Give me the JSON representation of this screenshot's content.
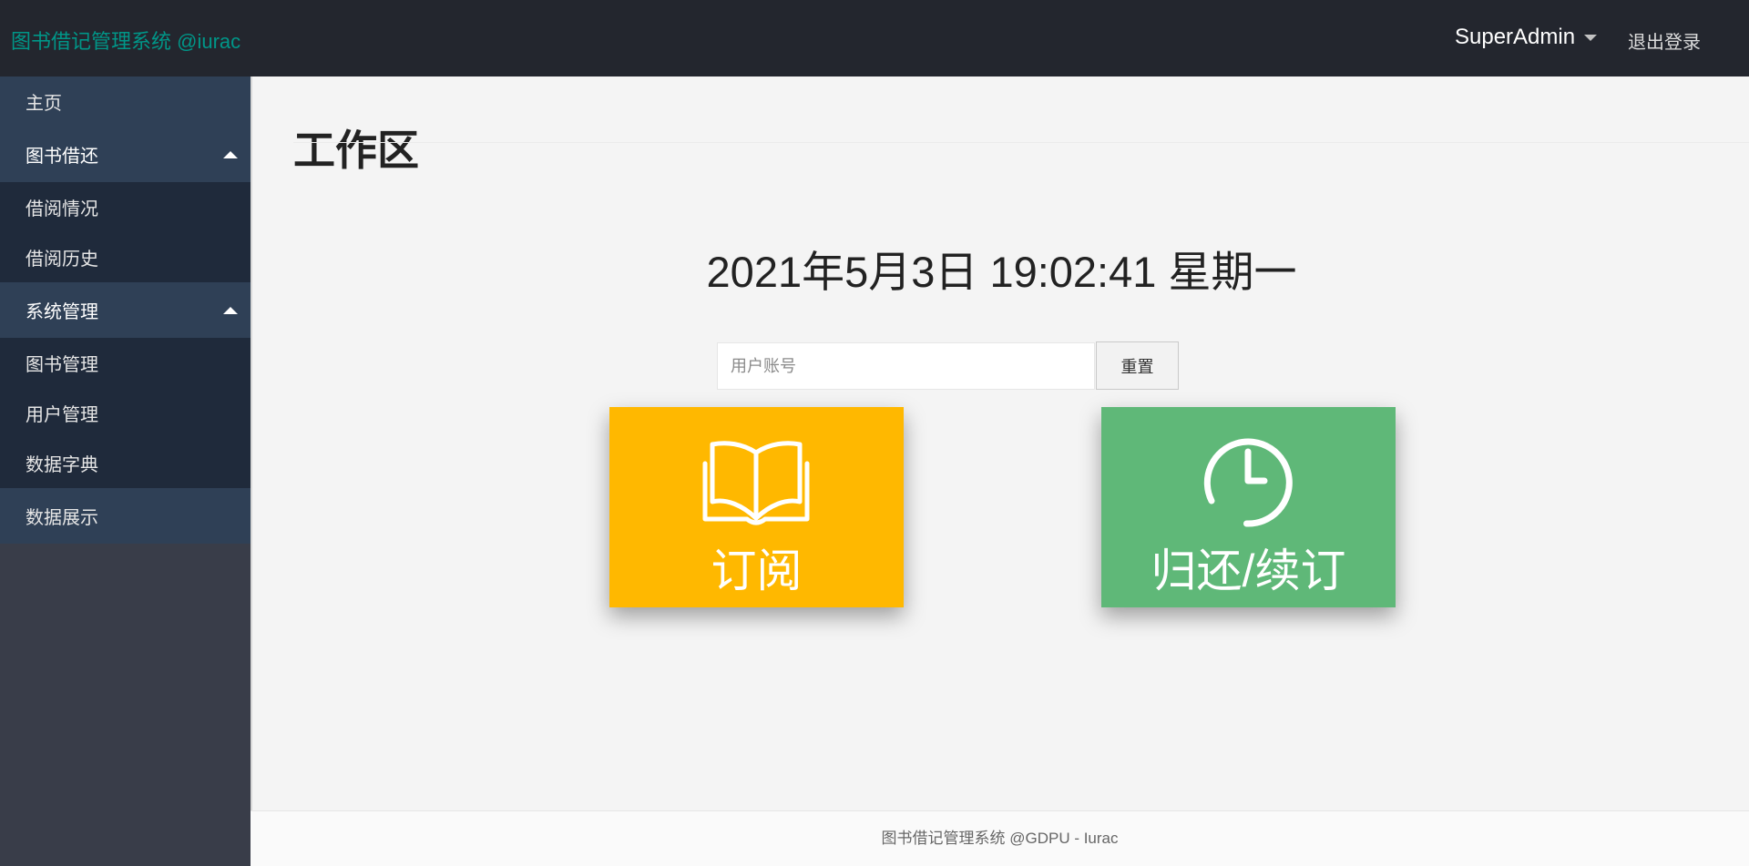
{
  "header": {
    "brand": "图书借记管理系统 @iurac",
    "user": "SuperAdmin",
    "logout": "退出登录"
  },
  "sidebar": {
    "home": "主页",
    "group1": {
      "label": "图书借还",
      "items": [
        "借阅情况",
        "借阅历史"
      ]
    },
    "group2": {
      "label": "系统管理",
      "items": [
        "图书管理",
        "用户管理",
        "数据字典"
      ]
    },
    "data_display": "数据展示"
  },
  "main": {
    "title": "工作区",
    "clock": "2021年5月3日 19:02:41 星期一",
    "search": {
      "placeholder": "用户账号",
      "value": ""
    },
    "reset": "重置",
    "tiles": [
      {
        "label": "订阅",
        "icon": "open-book-icon",
        "color": "#ffb800"
      },
      {
        "label": "归还/续订",
        "icon": "clock-icon",
        "color": "#5fb878"
      }
    ]
  },
  "footer": "图书借记管理系统 @GDPU - Iurac",
  "colors": {
    "topbar": "#23262e",
    "sidebar_bg": "#393d49",
    "sidebar_item": "#2f4056",
    "sidebar_sub": "#1f2a3b",
    "brand": "#009688"
  }
}
